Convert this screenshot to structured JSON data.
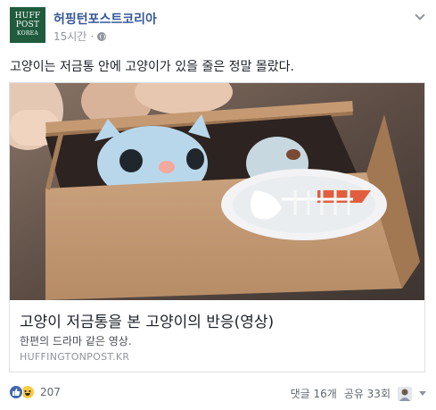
{
  "page": {
    "name": "허핑턴포스트코리아",
    "logo_lines": [
      "HUFF",
      "POST",
      "KOREA"
    ],
    "timestamp": "15시간",
    "separator": "·"
  },
  "post": {
    "text": "고양이는 저금통 안에 고양이가 있을 줄은 정말 몰랐다."
  },
  "link_card": {
    "title": "고양이 저금통을 본 고양이의 반응(영상)",
    "description": "한편의 드라마 같은 영상.",
    "domain": "HUFFINGTONPOST.KR"
  },
  "footer": {
    "reaction_count": "207",
    "comments": "댓글 16개",
    "shares": "공유 33회"
  },
  "colors": {
    "brand": "#1f5b3c",
    "link": "#365899",
    "like": "#4267b2",
    "haha": "#fbcb45"
  },
  "icons": [
    "globe-icon",
    "chevron-down-icon",
    "like-reaction-icon",
    "haha-reaction-icon",
    "caret-down-icon"
  ]
}
